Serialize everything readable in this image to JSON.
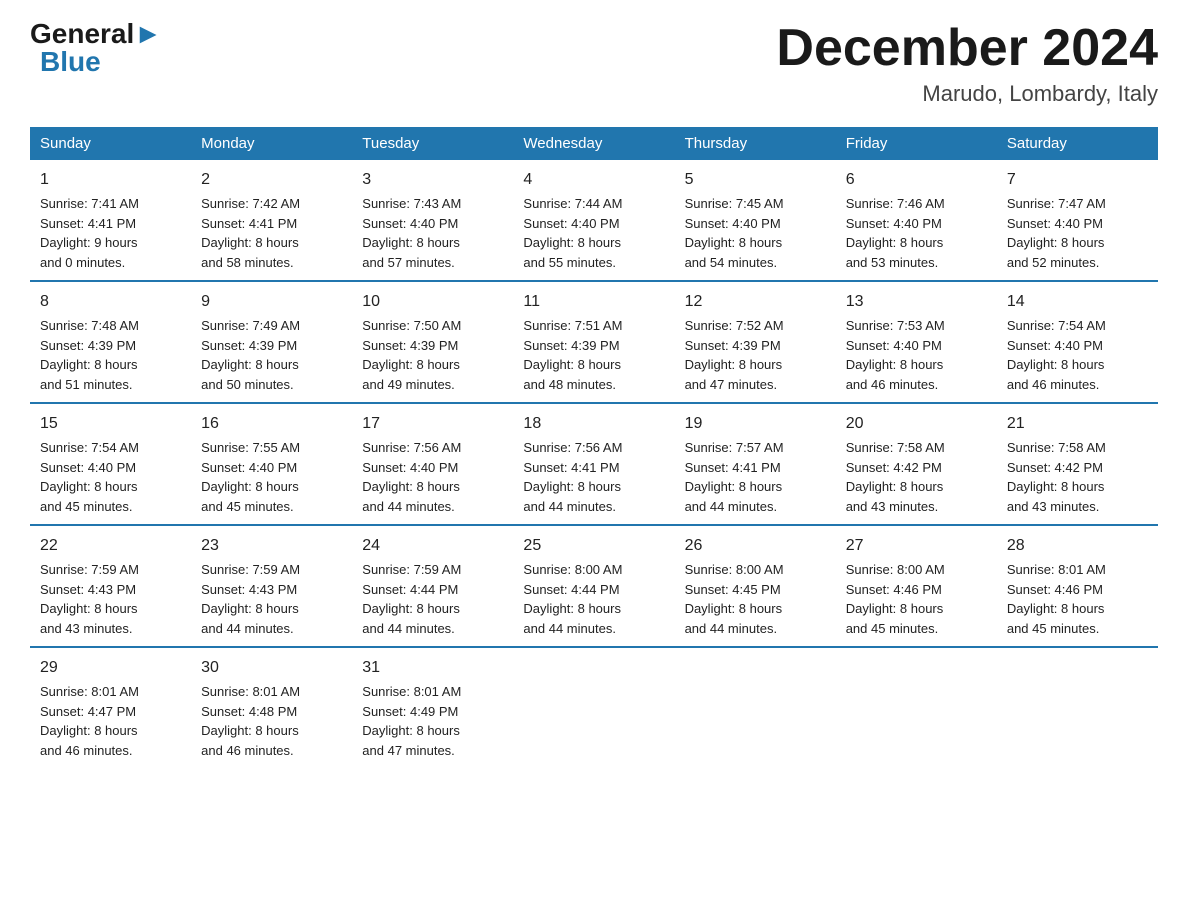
{
  "header": {
    "logo_general": "General",
    "logo_blue": "Blue",
    "month_title": "December 2024",
    "location": "Marudo, Lombardy, Italy"
  },
  "days_of_week": [
    "Sunday",
    "Monday",
    "Tuesday",
    "Wednesday",
    "Thursday",
    "Friday",
    "Saturday"
  ],
  "weeks": [
    [
      {
        "day": "1",
        "info": "Sunrise: 7:41 AM\nSunset: 4:41 PM\nDaylight: 9 hours\nand 0 minutes."
      },
      {
        "day": "2",
        "info": "Sunrise: 7:42 AM\nSunset: 4:41 PM\nDaylight: 8 hours\nand 58 minutes."
      },
      {
        "day": "3",
        "info": "Sunrise: 7:43 AM\nSunset: 4:40 PM\nDaylight: 8 hours\nand 57 minutes."
      },
      {
        "day": "4",
        "info": "Sunrise: 7:44 AM\nSunset: 4:40 PM\nDaylight: 8 hours\nand 55 minutes."
      },
      {
        "day": "5",
        "info": "Sunrise: 7:45 AM\nSunset: 4:40 PM\nDaylight: 8 hours\nand 54 minutes."
      },
      {
        "day": "6",
        "info": "Sunrise: 7:46 AM\nSunset: 4:40 PM\nDaylight: 8 hours\nand 53 minutes."
      },
      {
        "day": "7",
        "info": "Sunrise: 7:47 AM\nSunset: 4:40 PM\nDaylight: 8 hours\nand 52 minutes."
      }
    ],
    [
      {
        "day": "8",
        "info": "Sunrise: 7:48 AM\nSunset: 4:39 PM\nDaylight: 8 hours\nand 51 minutes."
      },
      {
        "day": "9",
        "info": "Sunrise: 7:49 AM\nSunset: 4:39 PM\nDaylight: 8 hours\nand 50 minutes."
      },
      {
        "day": "10",
        "info": "Sunrise: 7:50 AM\nSunset: 4:39 PM\nDaylight: 8 hours\nand 49 minutes."
      },
      {
        "day": "11",
        "info": "Sunrise: 7:51 AM\nSunset: 4:39 PM\nDaylight: 8 hours\nand 48 minutes."
      },
      {
        "day": "12",
        "info": "Sunrise: 7:52 AM\nSunset: 4:39 PM\nDaylight: 8 hours\nand 47 minutes."
      },
      {
        "day": "13",
        "info": "Sunrise: 7:53 AM\nSunset: 4:40 PM\nDaylight: 8 hours\nand 46 minutes."
      },
      {
        "day": "14",
        "info": "Sunrise: 7:54 AM\nSunset: 4:40 PM\nDaylight: 8 hours\nand 46 minutes."
      }
    ],
    [
      {
        "day": "15",
        "info": "Sunrise: 7:54 AM\nSunset: 4:40 PM\nDaylight: 8 hours\nand 45 minutes."
      },
      {
        "day": "16",
        "info": "Sunrise: 7:55 AM\nSunset: 4:40 PM\nDaylight: 8 hours\nand 45 minutes."
      },
      {
        "day": "17",
        "info": "Sunrise: 7:56 AM\nSunset: 4:40 PM\nDaylight: 8 hours\nand 44 minutes."
      },
      {
        "day": "18",
        "info": "Sunrise: 7:56 AM\nSunset: 4:41 PM\nDaylight: 8 hours\nand 44 minutes."
      },
      {
        "day": "19",
        "info": "Sunrise: 7:57 AM\nSunset: 4:41 PM\nDaylight: 8 hours\nand 44 minutes."
      },
      {
        "day": "20",
        "info": "Sunrise: 7:58 AM\nSunset: 4:42 PM\nDaylight: 8 hours\nand 43 minutes."
      },
      {
        "day": "21",
        "info": "Sunrise: 7:58 AM\nSunset: 4:42 PM\nDaylight: 8 hours\nand 43 minutes."
      }
    ],
    [
      {
        "day": "22",
        "info": "Sunrise: 7:59 AM\nSunset: 4:43 PM\nDaylight: 8 hours\nand 43 minutes."
      },
      {
        "day": "23",
        "info": "Sunrise: 7:59 AM\nSunset: 4:43 PM\nDaylight: 8 hours\nand 44 minutes."
      },
      {
        "day": "24",
        "info": "Sunrise: 7:59 AM\nSunset: 4:44 PM\nDaylight: 8 hours\nand 44 minutes."
      },
      {
        "day": "25",
        "info": "Sunrise: 8:00 AM\nSunset: 4:44 PM\nDaylight: 8 hours\nand 44 minutes."
      },
      {
        "day": "26",
        "info": "Sunrise: 8:00 AM\nSunset: 4:45 PM\nDaylight: 8 hours\nand 44 minutes."
      },
      {
        "day": "27",
        "info": "Sunrise: 8:00 AM\nSunset: 4:46 PM\nDaylight: 8 hours\nand 45 minutes."
      },
      {
        "day": "28",
        "info": "Sunrise: 8:01 AM\nSunset: 4:46 PM\nDaylight: 8 hours\nand 45 minutes."
      }
    ],
    [
      {
        "day": "29",
        "info": "Sunrise: 8:01 AM\nSunset: 4:47 PM\nDaylight: 8 hours\nand 46 minutes."
      },
      {
        "day": "30",
        "info": "Sunrise: 8:01 AM\nSunset: 4:48 PM\nDaylight: 8 hours\nand 46 minutes."
      },
      {
        "day": "31",
        "info": "Sunrise: 8:01 AM\nSunset: 4:49 PM\nDaylight: 8 hours\nand 47 minutes."
      },
      {
        "day": "",
        "info": ""
      },
      {
        "day": "",
        "info": ""
      },
      {
        "day": "",
        "info": ""
      },
      {
        "day": "",
        "info": ""
      }
    ]
  ]
}
